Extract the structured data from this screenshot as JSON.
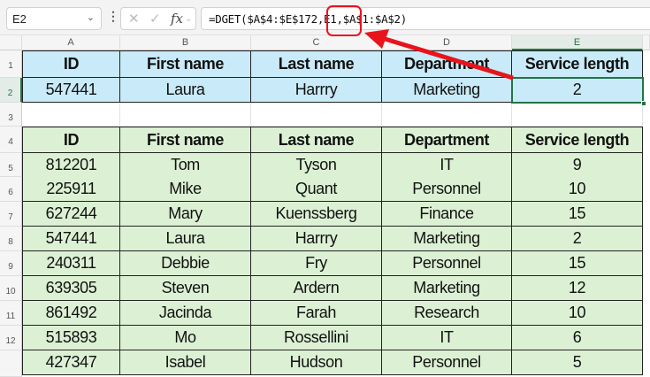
{
  "name_box": "E2",
  "formula": "=DGET($A$4:$E$172,E1,$A$1:$A$2)",
  "columns": [
    "A",
    "B",
    "C",
    "D",
    "E"
  ],
  "rows": [
    "1",
    "2",
    "3",
    "4",
    "5",
    "6",
    "7",
    "8",
    "9",
    "10",
    "11",
    "12"
  ],
  "criteria": {
    "headers": [
      "ID",
      "First name",
      "Last name",
      "Department",
      "Service length"
    ],
    "values": [
      "547441",
      "Laura",
      "Harrry",
      "Marketing",
      "2"
    ]
  },
  "table": {
    "headers": [
      "ID",
      "First name",
      "Last name",
      "Department",
      "Service length"
    ],
    "rows": [
      [
        "812201",
        "Tom",
        "Tyson",
        "IT",
        "9"
      ],
      [
        "225911",
        "Mike",
        "Quant",
        "Personnel",
        "10"
      ],
      [
        "627244",
        "Mary",
        "Kuenssberg",
        "Finance",
        "15"
      ],
      [
        "547441",
        "Laura",
        "Harrry",
        "Marketing",
        "2"
      ],
      [
        "240311",
        "Debbie",
        "Fry",
        "Personnel",
        "15"
      ],
      [
        "639305",
        "Steven",
        "Ardern",
        "Marketing",
        "12"
      ],
      [
        "861492",
        "Jacinda",
        "Farah",
        "Research",
        "10"
      ],
      [
        "515893",
        "Mo",
        "Rossellini",
        "IT",
        "6"
      ],
      [
        "427347",
        "Isabel",
        "Hudson",
        "Personnel",
        "5"
      ]
    ]
  },
  "colors": {
    "criteria_fill": "#c9eaf8",
    "table_fill": "#dcf1d4",
    "annotation": "#e8141c",
    "selection": "#217346"
  }
}
